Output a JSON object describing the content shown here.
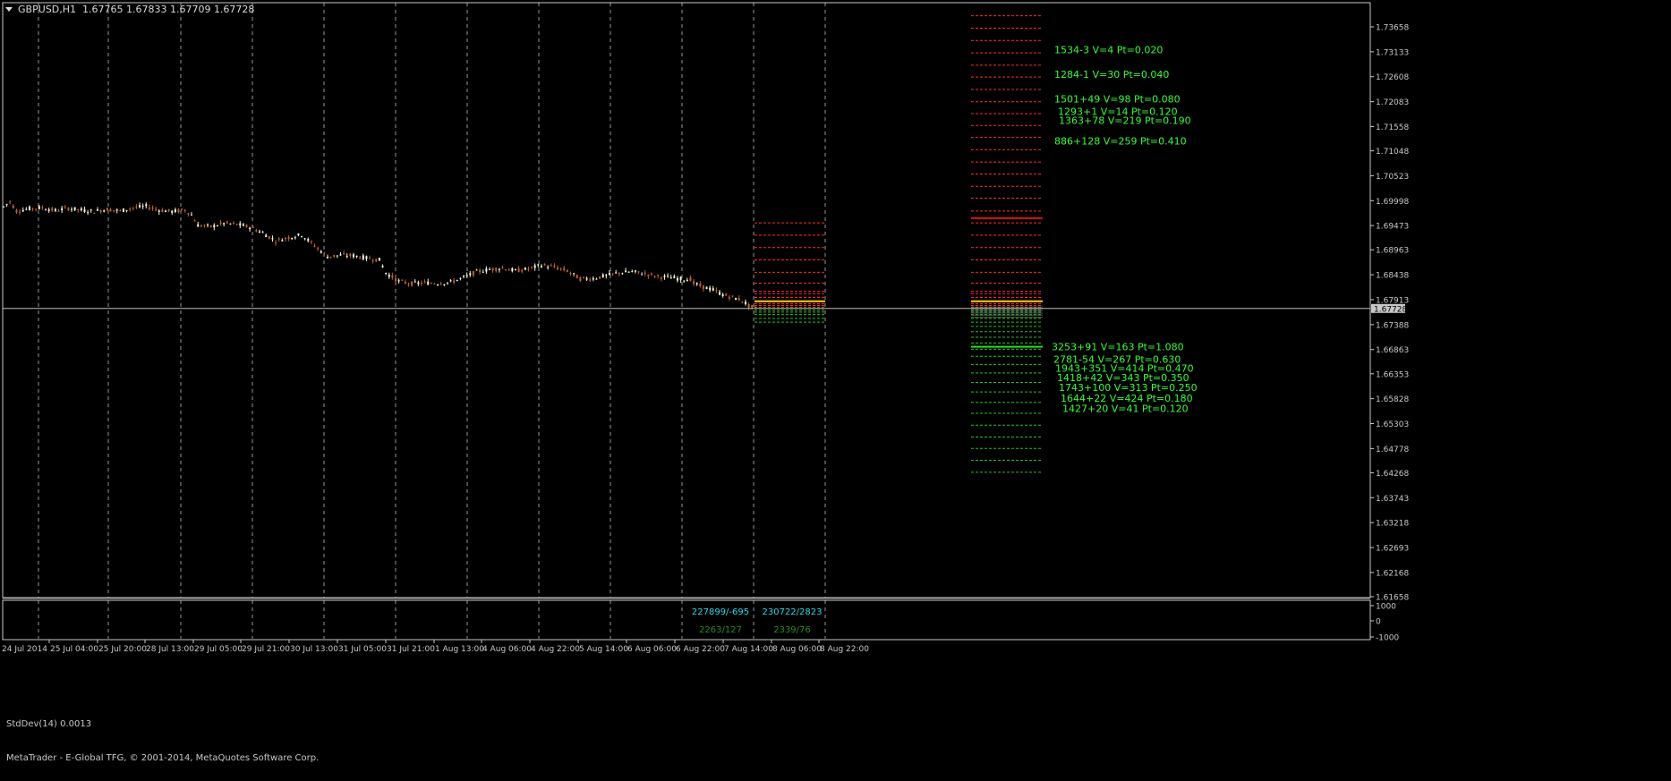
{
  "header": {
    "symbol": "GBPUSD,H1",
    "ohlc": "1.67765 1.67833 1.67709 1.67728"
  },
  "indicator": {
    "label": "StdDev(14) 0.0013",
    "scale_top": "1000",
    "scale_mid": "0",
    "scale_bottom": "-1000"
  },
  "footer": {
    "copyright": "MetaTrader - E-Global TFG, © 2001-2014, MetaQuotes Software Corp."
  },
  "colors": {
    "background": "#000000",
    "grid": "#c8c8c8",
    "bull": "#f5f5dc",
    "bear": "#c0602a",
    "resistance": "#ff2a2a",
    "support": "#22c322",
    "label": "#33ff33",
    "cyan": "#22d8e8"
  },
  "chart_data": {
    "type": "candlestick",
    "symbol": "GBPUSD",
    "timeframe": "H1",
    "current_price": "1.67728",
    "y_ticks": [
      "1.73658",
      "1.73133",
      "1.72608",
      "1.72083",
      "1.71558",
      "1.71048",
      "1.70523",
      "1.69998",
      "1.69473",
      "1.68963",
      "1.68438",
      "1.67913",
      "1.67388",
      "1.66863",
      "1.66353",
      "1.65828",
      "1.65303",
      "1.64778",
      "1.64268",
      "1.63743",
      "1.63218",
      "1.62693",
      "1.62168",
      "1.61658"
    ],
    "x_ticks": [
      "24 Jul 2014",
      "25 Jul 04:00",
      "25 Jul 20:00",
      "28 Jul 13:00",
      "29 Jul 05:00",
      "29 Jul 21:00",
      "30 Jul 13:00",
      "31 Jul 05:00",
      "31 Jul 21:00",
      "1 Aug 13:00",
      "4 Aug 06:00",
      "4 Aug 22:00",
      "5 Aug 14:00",
      "6 Aug 06:00",
      "6 Aug 22:00",
      "7 Aug 14:00",
      "8 Aug 06:00",
      "8 Aug 22:00"
    ],
    "price_path": [
      [
        0,
        1.6987
      ],
      [
        2,
        1.6998
      ],
      [
        4,
        1.6978
      ],
      [
        8,
        1.6983
      ],
      [
        12,
        1.6985
      ],
      [
        16,
        1.6979
      ],
      [
        20,
        1.6984
      ],
      [
        24,
        1.698
      ],
      [
        28,
        1.6977
      ],
      [
        32,
        1.6982
      ],
      [
        36,
        1.6978
      ],
      [
        40,
        1.6985
      ],
      [
        44,
        1.6988
      ],
      [
        48,
        1.698
      ],
      [
        52,
        1.6977
      ],
      [
        56,
        1.698
      ],
      [
        58,
        1.697
      ],
      [
        60,
        1.6948
      ],
      [
        64,
        1.6945
      ],
      [
        68,
        1.6952
      ],
      [
        72,
        1.695
      ],
      [
        76,
        1.6944
      ],
      [
        80,
        1.6932
      ],
      [
        84,
        1.6915
      ],
      [
        88,
        1.6922
      ],
      [
        92,
        1.6928
      ],
      [
        96,
        1.6905
      ],
      [
        100,
        1.6882
      ],
      [
        104,
        1.6885
      ],
      [
        108,
        1.6884
      ],
      [
        112,
        1.6879
      ],
      [
        116,
        1.6875
      ],
      [
        118,
        1.6848
      ],
      [
        122,
        1.683
      ],
      [
        126,
        1.6825
      ],
      [
        130,
        1.6827
      ],
      [
        134,
        1.6826
      ],
      [
        138,
        1.6828
      ],
      [
        142,
        1.6838
      ],
      [
        146,
        1.685
      ],
      [
        150,
        1.6855
      ],
      [
        154,
        1.6858
      ],
      [
        158,
        1.6852
      ],
      [
        162,
        1.6856
      ],
      [
        166,
        1.6864
      ],
      [
        170,
        1.686
      ],
      [
        174,
        1.6852
      ],
      [
        178,
        1.6835
      ],
      [
        182,
        1.6836
      ],
      [
        186,
        1.6842
      ],
      [
        190,
        1.6848
      ],
      [
        194,
        1.685
      ],
      [
        198,
        1.6846
      ],
      [
        202,
        1.684
      ],
      [
        206,
        1.6838
      ],
      [
        210,
        1.6834
      ],
      [
        212,
        1.6835
      ],
      [
        213,
        1.6826
      ],
      [
        216,
        1.6818
      ],
      [
        219,
        1.6812
      ],
      [
        222,
        1.6802
      ],
      [
        225,
        1.6796
      ],
      [
        228,
        1.679
      ],
      [
        230,
        1.6778
      ],
      [
        232,
        1.6773
      ]
    ],
    "resistance_levels": [
      1.7389,
      1.7363,
      1.7337,
      1.7311,
      1.7285,
      1.726,
      1.7234,
      1.7208,
      1.7183,
      1.7158,
      1.7133,
      1.7107,
      1.7081,
      1.7056,
      1.703,
      1.7005,
      1.6978,
      1.6953,
      1.6927,
      1.6901,
      1.6875,
      1.6849,
      1.6826,
      1.6809,
      1.6804,
      1.6796,
      1.6788,
      1.6783,
      1.6779,
      1.6775
    ],
    "support_levels": [
      1.6769,
      1.6765,
      1.676,
      1.6752,
      1.6744,
      1.6735,
      1.6724,
      1.6712,
      1.67,
      1.6687,
      1.6672,
      1.6655,
      1.6637,
      1.6617,
      1.6597,
      1.6575,
      1.6552,
      1.6527,
      1.6502,
      1.6478,
      1.6453,
      1.6428
    ],
    "strong_levels": [
      {
        "price": 1.6963,
        "color": "#e01010"
      },
      {
        "price": 1.6788,
        "color": "#ffd000"
      },
      {
        "price": 1.6692,
        "color": "#22e022"
      }
    ],
    "level_labels": [
      {
        "text": "1534-3 V=4 Pt=0.020",
        "price": 1.7318,
        "side": "resistance"
      },
      {
        "text": "1284-1 V=30 Pt=0.040",
        "price": 1.7266,
        "side": "resistance"
      },
      {
        "text": "1501+49 V=98 Pt=0.080",
        "price": 1.7214,
        "side": "resistance"
      },
      {
        "text": "1293+1 V=14 Pt=0.120",
        "price": 1.7188,
        "side": "resistance"
      },
      {
        "text": "1363+78 V=219 Pt=0.190",
        "price": 1.7169,
        "side": "resistance"
      },
      {
        "text": "886+128 V=259 Pt=0.410",
        "price": 1.7126,
        "side": "resistance"
      },
      {
        "text": "3253+91 V=163 Pt=1.080",
        "price": 1.6692,
        "side": "support"
      },
      {
        "text": "2781-54 V=267 Pt=0.630",
        "price": 1.6666,
        "side": "support"
      },
      {
        "text": "1943+351 V=414 Pt=0.470",
        "price": 1.6647,
        "side": "support"
      },
      {
        "text": "1418+42 V=343 Pt=0.350",
        "price": 1.6627,
        "side": "support"
      },
      {
        "text": "1743+100 V=313 Pt=0.250",
        "price": 1.6607,
        "side": "support"
      },
      {
        "text": "1644+22 V=424 Pt=0.180",
        "price": 1.6584,
        "side": "support"
      },
      {
        "text": "1427+20 V=41 Pt=0.120",
        "price": 1.6562,
        "side": "support"
      }
    ],
    "annotations": [
      {
        "text": "227899/-695",
        "color": "#22d8e8",
        "slot": 0
      },
      {
        "text": "230722/2823",
        "color": "#22d8e8",
        "slot": 1
      },
      {
        "text": "2263/127",
        "color": "#2a8a2a",
        "slot": 0
      },
      {
        "text": "2339/76",
        "color": "#2a8a2a",
        "slot": 1
      }
    ]
  }
}
